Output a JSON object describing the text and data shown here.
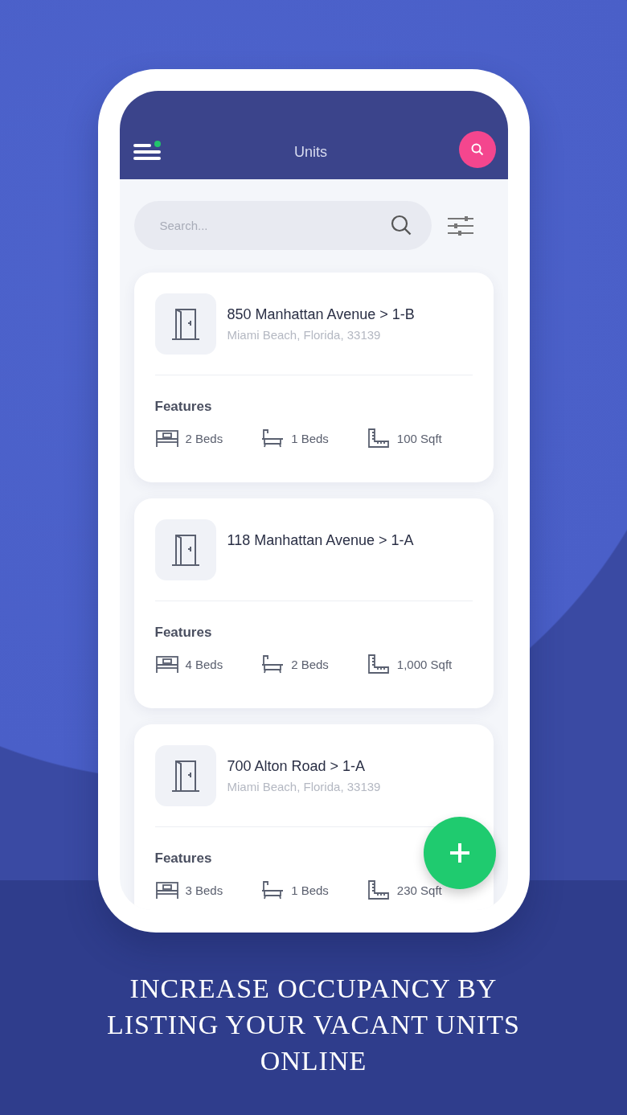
{
  "app_bar": {
    "title": "Units"
  },
  "search": {
    "placeholder": "Search..."
  },
  "units": [
    {
      "title": "850 Manhattan Avenue > 1-B",
      "subtitle": "Miami Beach, Florida, 33139",
      "features_label": "Features",
      "features": [
        {
          "kind": "bed",
          "text": "2 Beds"
        },
        {
          "kind": "bath",
          "text": "1 Beds"
        },
        {
          "kind": "area",
          "text": "100 Sqft"
        }
      ]
    },
    {
      "title": "118 Manhattan Avenue > 1-A",
      "features_label": "Features",
      "features": [
        {
          "kind": "bed",
          "text": "4 Beds"
        },
        {
          "kind": "bath",
          "text": "2 Beds"
        },
        {
          "kind": "area",
          "text": "1,000 Sqft"
        }
      ]
    },
    {
      "title": "700 Alton Road > 1-A",
      "subtitle": "Miami Beach, Florida, 33139",
      "features_label": "Features",
      "features": [
        {
          "kind": "bed",
          "text": "3 Beds"
        },
        {
          "kind": "bath",
          "text": "1 Beds"
        },
        {
          "kind": "area",
          "text": "230 Sqft"
        }
      ]
    }
  ],
  "caption": "INCREASE OCCUPANCY BY LISTING YOUR VACANT UNITS ONLINE"
}
